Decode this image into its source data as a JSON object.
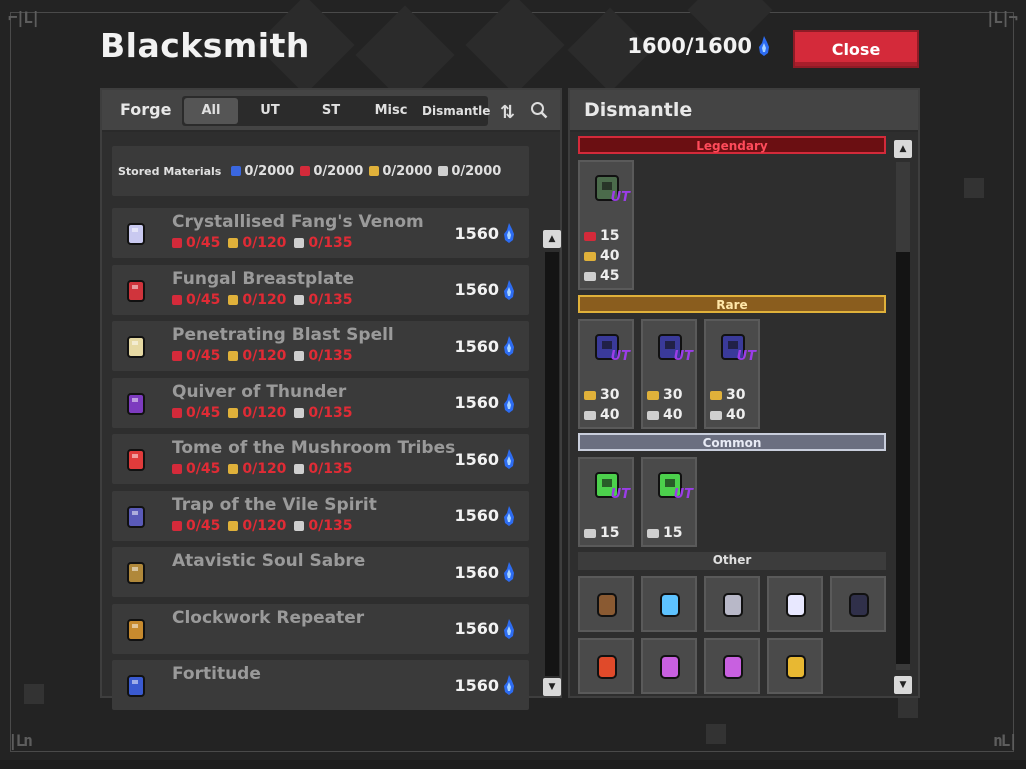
{
  "window": {
    "title": "Blacksmith",
    "fame": "1600/1600",
    "close_label": "Close"
  },
  "left": {
    "forge_label": "Forge",
    "tabs": [
      "All",
      "UT",
      "ST",
      "Misc",
      "Dismantle"
    ],
    "stored_label": "Stored Materials",
    "stored": [
      {
        "value": "0/2000",
        "color": "#3a67e0",
        "icon": "blue-material-icon"
      },
      {
        "value": "0/2000",
        "color": "#d42a3a",
        "icon": "red-material-icon"
      },
      {
        "value": "0/2000",
        "color": "#e0b13a",
        "icon": "gold-material-icon"
      },
      {
        "value": "0/2000",
        "color": "#cfcfcf",
        "icon": "silver-material-icon"
      }
    ],
    "items": [
      {
        "name": "Crystallised Fang's Venom",
        "costs": [
          "0/45",
          "0/120",
          "0/135"
        ],
        "price": "1560",
        "icon_color": "#c9c9f0"
      },
      {
        "name": "Fungal Breastplate",
        "costs": [
          "0/45",
          "0/120",
          "0/135"
        ],
        "price": "1560",
        "icon_color": "#d0343c"
      },
      {
        "name": "Penetrating Blast Spell",
        "costs": [
          "0/45",
          "0/120",
          "0/135"
        ],
        "price": "1560",
        "icon_color": "#e6d9a3"
      },
      {
        "name": "Quiver of Thunder",
        "costs": [
          "0/45",
          "0/120",
          "0/135"
        ],
        "price": "1560",
        "icon_color": "#7d3bbf"
      },
      {
        "name": "Tome of the Mushroom Tribes",
        "costs": [
          "0/45",
          "0/120",
          "0/135"
        ],
        "price": "1560",
        "icon_color": "#e03b3b"
      },
      {
        "name": "Trap of the Vile Spirit",
        "costs": [
          "0/45",
          "0/120",
          "0/135"
        ],
        "price": "1560",
        "icon_color": "#5a5ab8"
      },
      {
        "name": "Atavistic Soul Sabre",
        "costs": [],
        "price": "1560",
        "icon_color": "#b0883a"
      },
      {
        "name": "Clockwork Repeater",
        "costs": [],
        "price": "1560",
        "icon_color": "#c78a2e"
      },
      {
        "name": "Fortitude",
        "costs": [],
        "price": "1560",
        "icon_color": "#3a5ad0"
      }
    ]
  },
  "right": {
    "title": "Dismantle",
    "legendary_label": "Legendary",
    "rare_label": "Rare",
    "common_label": "Common",
    "other_label": "Other",
    "ut_badge": "UT",
    "legendary": [
      {
        "stats": [
          "15",
          "40",
          "45"
        ]
      }
    ],
    "rare": [
      {
        "stats": [
          "30",
          "40"
        ]
      },
      {
        "stats": [
          "30",
          "40"
        ]
      },
      {
        "stats": [
          "30",
          "40"
        ]
      }
    ],
    "common": [
      {
        "stats": [
          "15"
        ]
      },
      {
        "stats": [
          "15"
        ]
      }
    ],
    "other_colors": [
      "#8a5a32",
      "#5ec3ff",
      "#b8b8c8",
      "#e8e8ff",
      "#30304a",
      "#e04a2a",
      "#c860e0",
      "#c860e0",
      "#e8b832"
    ]
  }
}
